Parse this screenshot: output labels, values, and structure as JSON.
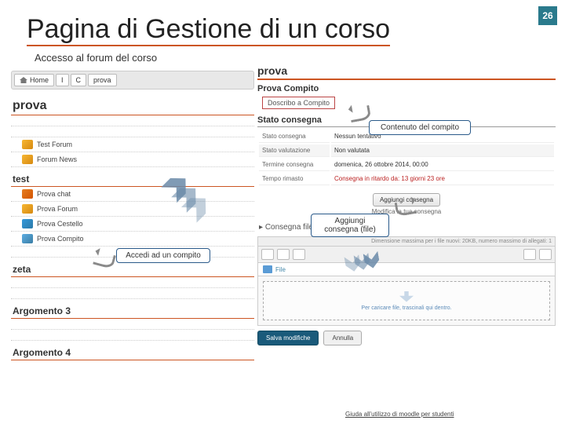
{
  "page_number": "26",
  "title": "Pagina di Gestione di un corso",
  "subtitle": "Accesso al forum del corso",
  "left": {
    "breadcrumb": {
      "home": "Home",
      "i": "I",
      "c": "C",
      "last": "prova"
    },
    "course": "prova",
    "forum_items": [
      "Test Forum",
      "Forum News"
    ],
    "test_title": "test",
    "test_items": [
      "Prova chat",
      "Prova Forum",
      "Prova Cestello",
      "Prova Compito"
    ],
    "zeta": "zeta",
    "arg3": "Argomento 3",
    "arg4": "Argomento 4"
  },
  "right": {
    "head": "prova",
    "sub": "Prova Compito",
    "link": "Doscribo a Compito",
    "stato_title": "Stato consegna",
    "rows": {
      "r1k": "Stato consegna",
      "r1v": "Nessun tentativo",
      "r2k": "Stato valutazione",
      "r2v": "Non valutata",
      "r3k": "Termine consegna",
      "r3v": "domenica, 26 ottobre 2014, 00:00",
      "r4k": "Tempo rimasto",
      "r4v": "Consegna in ritardo da: 13 giorni 23 ore"
    },
    "btn_add": "Aggiungi consegna",
    "modify": "Modifica la tua consegna",
    "consegna_file": "Consegna file",
    "upload_hint": "Dimensione massima per i file nuovi: 20KB, numero massimo di allegati: 1",
    "path": "File",
    "drop": "Per caricare file, trascinali qui dentro.",
    "save": "Salva modifiche",
    "cancel": "Annulla"
  },
  "callouts": {
    "c1": "Accedi ad un compito",
    "c2": "Aggiungi consegna (file)",
    "c3": "Contenuto del compito"
  },
  "footer": "Giuda all'utilizzo di moodle per studenti"
}
